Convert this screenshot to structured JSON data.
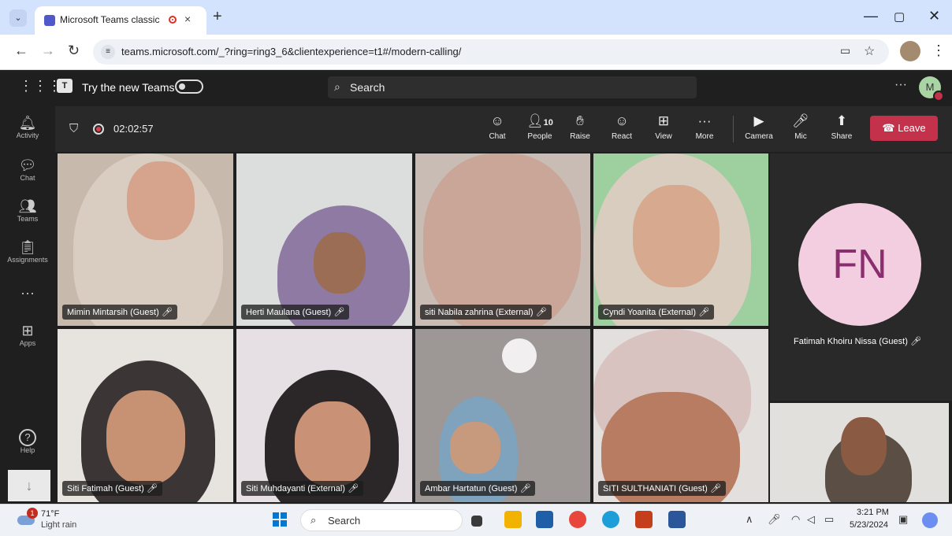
{
  "browser": {
    "tab_title": "Microsoft Teams classic",
    "tab_close": "×",
    "new_tab": "+",
    "tablist": "⌄",
    "url": "teams.microsoft.com/_?ring=ring3_6&clientexperience=t1#/modern-calling/",
    "window_controls": {
      "minimize": "—",
      "restore": "▢",
      "close": "✕"
    }
  },
  "teams_header": {
    "try_new": "Try the new Teams",
    "search_placeholder": "Search",
    "user_initial": "M",
    "logo": "T",
    "more": "···"
  },
  "rail": {
    "items": [
      {
        "label": "Activity",
        "icon": "bell-icon",
        "glyph": "🔔︎"
      },
      {
        "label": "Chat",
        "icon": "chat-icon",
        "glyph": "💬︎"
      },
      {
        "label": "Teams",
        "icon": "teams-icon",
        "glyph": "👥︎"
      },
      {
        "label": "Assignments",
        "icon": "assignments-icon",
        "glyph": "📋︎"
      },
      {
        "label": "",
        "icon": "more-icon",
        "glyph": "···"
      },
      {
        "label": "Apps",
        "icon": "apps-icon",
        "glyph": "⊞"
      },
      {
        "label": "Help",
        "icon": "help-icon",
        "glyph": "?"
      }
    ],
    "download_glyph": "↓"
  },
  "meeting": {
    "timer": "02:02:57",
    "people_count": "10",
    "controls": [
      {
        "label": "Chat",
        "glyph": "☺"
      },
      {
        "label": "People",
        "glyph": "👤︎"
      },
      {
        "label": "Raise",
        "glyph": "✋︎"
      },
      {
        "label": "React",
        "glyph": "☺"
      },
      {
        "label": "View",
        "glyph": "⊞"
      },
      {
        "label": "More",
        "glyph": "···"
      },
      {
        "label": "Camera",
        "glyph": "▶"
      },
      {
        "label": "Mic",
        "glyph": "🎤︎"
      },
      {
        "label": "Share",
        "glyph": "⬆"
      }
    ],
    "leave_label": "Leave",
    "leave_glyph": "☎"
  },
  "participants": [
    {
      "name": "Mimin Mintarsih (Guest)"
    },
    {
      "name": "Herti Maulana (Guest)"
    },
    {
      "name": "siti Nabila zahrina (External)"
    },
    {
      "name": "Cyndi Yoanita (External)"
    },
    {
      "name": "Siti Fatimah (Guest)"
    },
    {
      "name": "Siti Muhdayanti (External)"
    },
    {
      "name": "Ambar Hartatun (Guest)"
    },
    {
      "name": "SITI SULTHANIATI (Guest)"
    }
  ],
  "muted_glyph": "🎤︎",
  "avatar_participant": {
    "initials": "FN",
    "name": "Fatimah Khoiru Nissa (Guest)"
  },
  "taskbar": {
    "temperature": "71°F",
    "condition": "Light rain",
    "weather_badge": "1",
    "search_label": "Search",
    "time": "3:21 PM",
    "date": "5/23/2024"
  }
}
